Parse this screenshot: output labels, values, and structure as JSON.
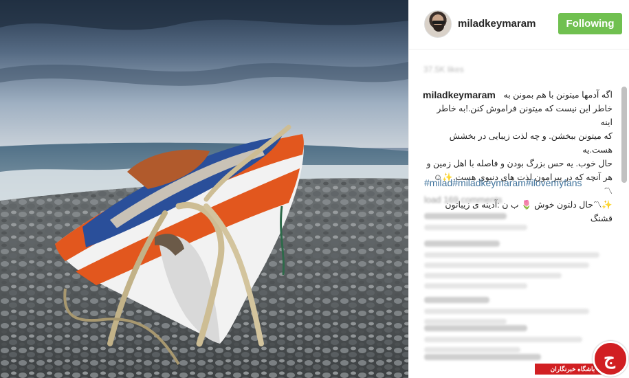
{
  "post": {
    "username": "miladkeymaram",
    "follow_label": "Following",
    "timestamp": "37.5K likes",
    "caption_user": "miladkeymaram",
    "caption_lines": [
      "اگه آدمها میتونن با هم بمونن به",
      "خاطر این نیست که میتونن فراموش کنن.!به خاطر اینه",
      "که میتونن ببخشن. و چه لذت زیبایی در بخشش هست.یه",
      "حال خوب. یه حس بزرگ بودن و فاصله با اهل زمین و",
      "هر آنچه که در پیرامون لذت های دنیوی هست.✨☺",
      "〽",
      "✨〽حال دلتون خوش 🌷 ب ن :آدینه ی زیباتون قشنگ"
    ],
    "hashtags": "#milad#miladkeymaram#ilovemyfans",
    "load_more": "load 169 comments"
  },
  "watermark": {
    "text": "باشگاه خبرنگاران",
    "logo_glyph": "ج"
  },
  "colors": {
    "follow_green": "#70c050",
    "hashtag_blue": "#3f729b",
    "watermark_red": "#d11f22"
  },
  "icons": {
    "avatar": "profile-photo",
    "watermark": "news-agency-logo"
  }
}
